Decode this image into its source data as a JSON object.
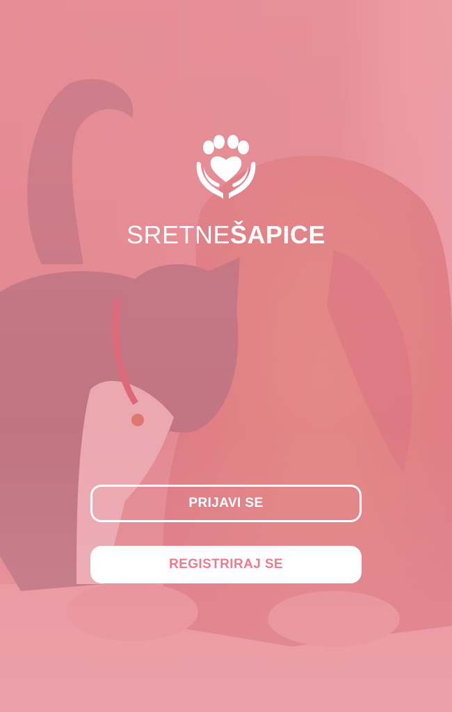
{
  "brand": {
    "name_light": "SRETNE",
    "name_bold": "ŠAPICE",
    "logo_icon": "paw-heart-hands-icon"
  },
  "actions": {
    "login_label": "PRIJAVI SE",
    "register_label": "REGISTRIRAJ SE"
  },
  "colors": {
    "tint": "#e38b93",
    "accent": "#ec7b8c",
    "text": "#ffffff"
  }
}
